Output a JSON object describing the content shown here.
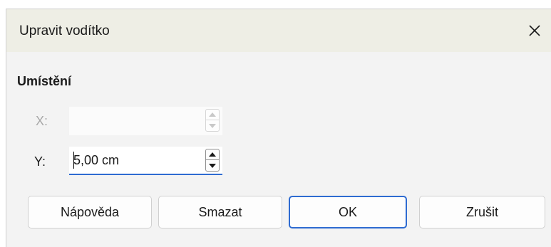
{
  "dialog": {
    "title": "Upravit vodítko",
    "close_icon": "close-icon"
  },
  "position": {
    "heading": "Umístění",
    "x": {
      "label": "X:",
      "value": "",
      "enabled": false
    },
    "y": {
      "label": "Y:",
      "value": "5,00 cm",
      "enabled": true
    }
  },
  "buttons": {
    "help": "Nápověda",
    "delete": "Smazat",
    "ok": "OK",
    "cancel": "Zrušit"
  },
  "colors": {
    "accent": "#2e6bd1",
    "titlebar": "#eeeee5",
    "dialog_bg": "#f3f3f3",
    "disabled_text": "#a8a8a8"
  }
}
